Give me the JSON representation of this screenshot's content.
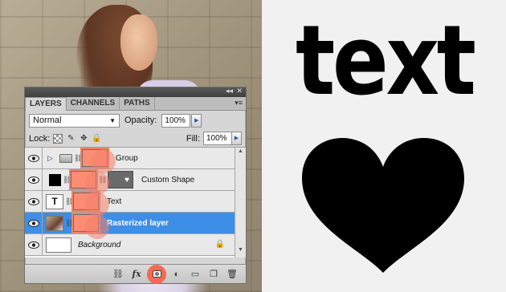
{
  "art": {
    "text": "text",
    "heart_color": "#000000"
  },
  "panel": {
    "tabs": [
      {
        "label": "LAYERS",
        "active": true
      },
      {
        "label": "CHANNELS",
        "active": false
      },
      {
        "label": "PATHS",
        "active": false
      }
    ],
    "blend_mode": "Normal",
    "opacity_label": "Opacity:",
    "opacity_value": "100%",
    "lock_label": "Lock:",
    "fill_label": "Fill:",
    "fill_value": "100%",
    "layers": [
      {
        "name": "Group",
        "type": "group",
        "visible": true,
        "selected": false
      },
      {
        "name": "Custom Shape",
        "type": "shape",
        "visible": true,
        "selected": false
      },
      {
        "name": "Text",
        "type": "text",
        "visible": true,
        "selected": false,
        "thumb_glyph": "T"
      },
      {
        "name": "Rasterized layer",
        "type": "raster",
        "visible": true,
        "selected": true
      },
      {
        "name": "Background",
        "type": "background",
        "visible": true,
        "selected": false,
        "locked": true
      }
    ],
    "bottom_tools": [
      "link-layers",
      "fx",
      "add-mask",
      "adjustment",
      "new-group",
      "new-layer",
      "delete"
    ],
    "fx_label": "fx",
    "mask_color": "#fb8d74",
    "selection_color": "#3d8ee6"
  }
}
